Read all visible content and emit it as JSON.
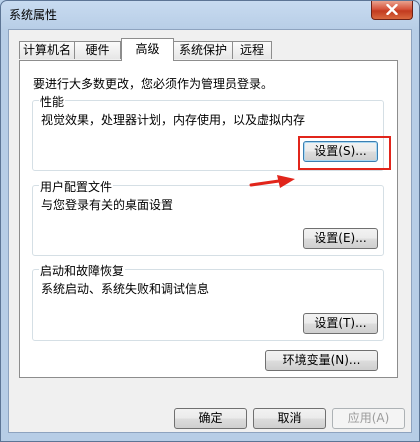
{
  "window": {
    "title": "系统属性",
    "close_icon": "close-icon"
  },
  "tabs": [
    {
      "label": "计算机名",
      "active": false
    },
    {
      "label": "硬件",
      "active": false
    },
    {
      "label": "高级",
      "active": true
    },
    {
      "label": "系统保护",
      "active": false
    },
    {
      "label": "远程",
      "active": false
    }
  ],
  "advanced": {
    "intro": "要进行大多数更改，您必须作为管理员登录。",
    "performance": {
      "title": "性能",
      "description": "视觉效果，处理器计划，内存使用，以及虚拟内存",
      "settings_button": "设置(S)..."
    },
    "user_profiles": {
      "title": "用户配置文件",
      "description": "与您登录有关的桌面设置",
      "settings_button": "设置(E)..."
    },
    "startup_recovery": {
      "title": "启动和故障恢复",
      "description": "系统启动、系统失败和调试信息",
      "settings_button": "设置(T)..."
    },
    "env_vars_button": "环境变量(N)..."
  },
  "footer": {
    "ok": "确定",
    "cancel": "取消",
    "apply": "应用(A)"
  },
  "annotation": {
    "color": "#e1251b"
  }
}
